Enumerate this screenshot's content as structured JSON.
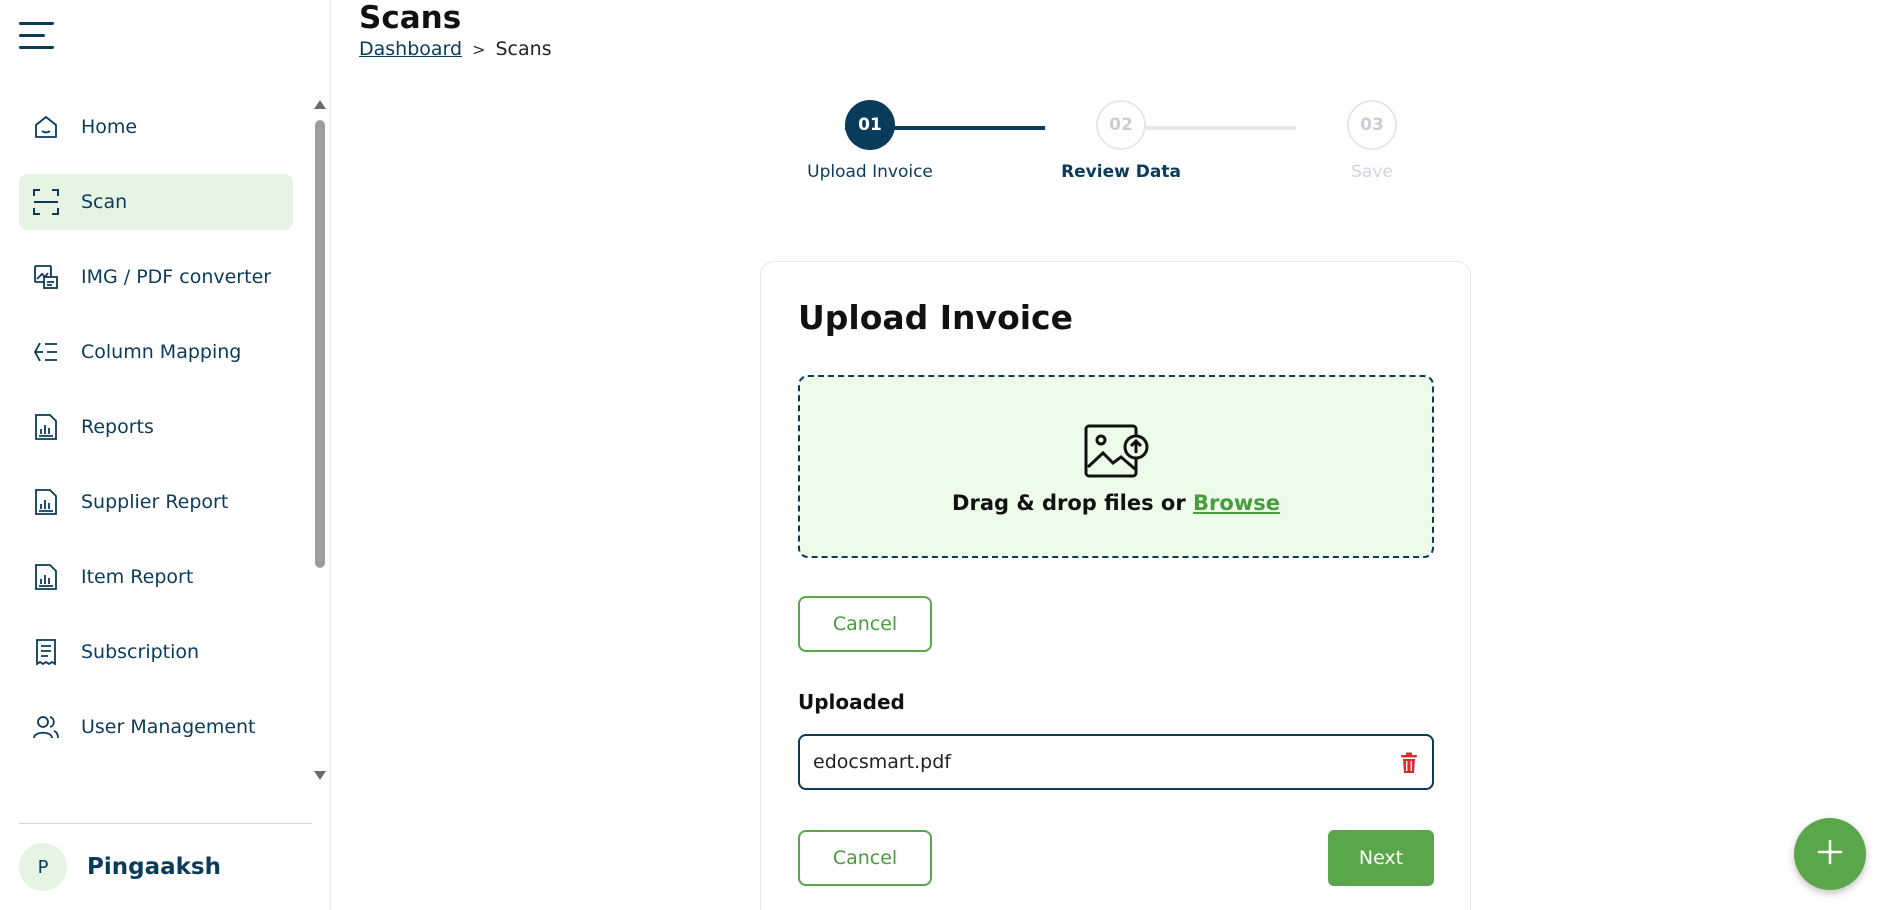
{
  "header": {
    "title": "Scans",
    "breadcrumb": {
      "link": "Dashboard",
      "separator": ">",
      "current": "Scans"
    }
  },
  "sidebar": {
    "items": [
      {
        "label": "Home",
        "icon": "home-icon",
        "active": false
      },
      {
        "label": "Scan",
        "icon": "scan-icon",
        "active": true
      },
      {
        "label": "IMG / PDF converter",
        "icon": "converter-icon",
        "active": false
      },
      {
        "label": "Column Mapping",
        "icon": "column-mapping-icon",
        "active": false
      },
      {
        "label": "Reports",
        "icon": "report-icon",
        "active": false
      },
      {
        "label": "Supplier Report",
        "icon": "report-icon",
        "active": false
      },
      {
        "label": "Item Report",
        "icon": "report-icon",
        "active": false
      },
      {
        "label": "Subscription",
        "icon": "receipt-icon",
        "active": false
      },
      {
        "label": "User Management",
        "icon": "users-icon",
        "active": false
      }
    ],
    "user": {
      "initial": "P",
      "name": "Pingaaksh"
    }
  },
  "stepper": {
    "steps": [
      {
        "number": "01",
        "label": "Upload Invoice",
        "state": "active"
      },
      {
        "number": "02",
        "label": "Review Data",
        "state": "next"
      },
      {
        "number": "03",
        "label": "Save",
        "state": "disabled"
      }
    ]
  },
  "upload": {
    "title": "Upload Invoice",
    "dropzone_text": "Drag & drop files or ",
    "browse_label": "Browse",
    "cancel_label": "Cancel",
    "uploaded_label": "Uploaded",
    "file_name": "edocsmart.pdf",
    "footer_cancel_label": "Cancel",
    "next_label": "Next"
  },
  "colors": {
    "primary": "#0b3b5a",
    "accent": "#5aa64a",
    "active_bg": "#e6f4e4",
    "dropzone_bg": "#edfbe9",
    "danger": "#d32f2f"
  }
}
